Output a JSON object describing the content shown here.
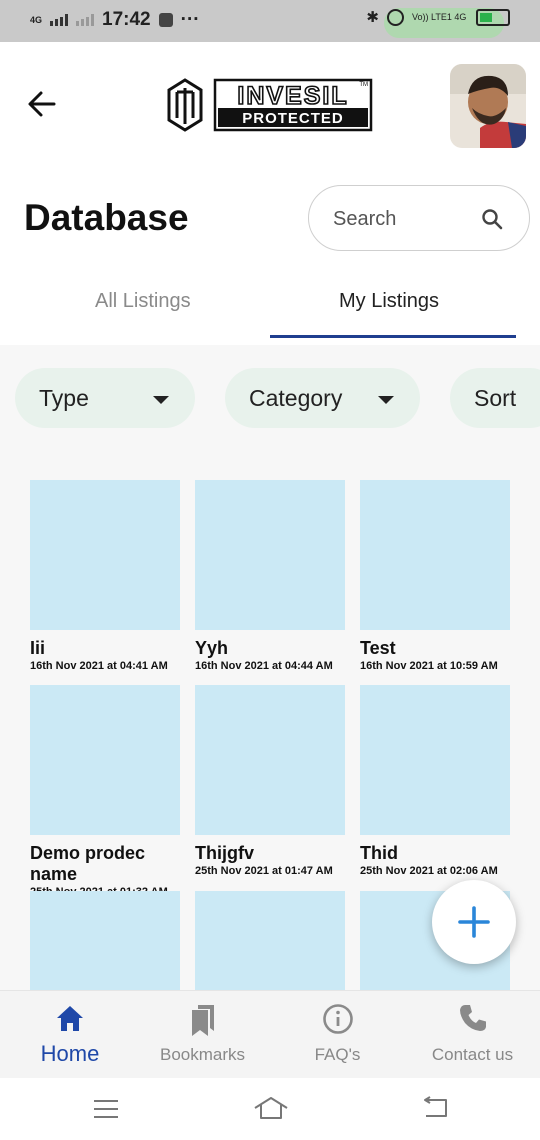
{
  "status_bar": {
    "network": "4G",
    "time": "17:42",
    "right_text": "Vo)) LTE1 4G"
  },
  "header": {
    "logo_line1": "INVESIL",
    "logo_line2": "PROTECTED",
    "logo_tm": "TM"
  },
  "page": {
    "title": "Database",
    "search_placeholder": "Search"
  },
  "tabs": [
    {
      "label": "All Listings",
      "active": false
    },
    {
      "label": "My Listings",
      "active": true
    }
  ],
  "filters": [
    {
      "label": "Type",
      "dropdown": true
    },
    {
      "label": "Category",
      "dropdown": true
    },
    {
      "label": "Sort",
      "dropdown": false
    }
  ],
  "listings": [
    {
      "name": "Iii",
      "date": "16th Nov 2021 at 04:41 AM"
    },
    {
      "name": "Yyh",
      "date": "16th Nov 2021 at 04:44 AM"
    },
    {
      "name": "Test",
      "date": "16th Nov 2021 at 10:59 AM"
    },
    {
      "name": "Demo prodec name",
      "date": "25th Nov 2021 at 01:32 AM"
    },
    {
      "name": "Thijgfv",
      "date": "25th Nov 2021 at 01:47 AM"
    },
    {
      "name": "Thid",
      "date": "25th Nov 2021 at 02:06 AM"
    },
    {
      "name": "",
      "date": ""
    },
    {
      "name": "",
      "date": ""
    },
    {
      "name": "",
      "date": ""
    }
  ],
  "colors": {
    "accent": "#1f48a8",
    "fab_plus": "#2a86d9",
    "thumb": "#cbe9f5",
    "chip": "#e8f2ec"
  },
  "bottom_nav": [
    {
      "label": "Home",
      "icon": "home-icon",
      "active": true
    },
    {
      "label": "Bookmarks",
      "icon": "bookmarks-icon",
      "active": false
    },
    {
      "label": "FAQ's",
      "icon": "info-icon",
      "active": false
    },
    {
      "label": "Contact us",
      "icon": "phone-icon",
      "active": false
    }
  ]
}
